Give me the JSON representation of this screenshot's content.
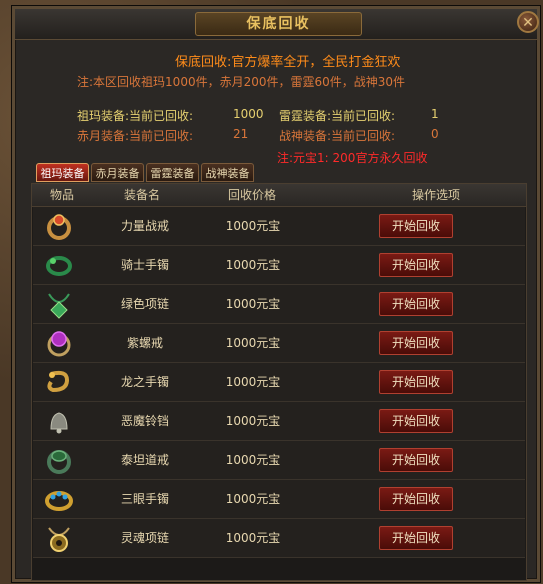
{
  "window": {
    "title": "保底回收",
    "close_symbol": "✕"
  },
  "info": {
    "headline": "保底回收:官方爆率全开，全民打金狂欢",
    "note_limit": "注:本区回收祖玛1000件，赤月200件，雷霆60件，战神30件",
    "stats": [
      {
        "label": "祖玛装备:当前已回收:",
        "value": "1000"
      },
      {
        "label": "雷霆装备:当前已回收:",
        "value": "1"
      },
      {
        "label": "赤月装备:当前已回收:",
        "value": "21"
      },
      {
        "label": "战神装备:当前已回收:",
        "value": "0"
      }
    ],
    "note_rate": "注:元宝1: 200官方永久回收"
  },
  "tabs": [
    "祖玛装备",
    "赤月装备",
    "雷霆装备",
    "战神装备"
  ],
  "table": {
    "headers": [
      "物品",
      "装备名",
      "回收价格",
      "操作选项"
    ],
    "rows": [
      {
        "name": "力量战戒",
        "price": "1000元宝",
        "button": "开始回收",
        "icon": "ring-icon"
      },
      {
        "name": "骑士手镯",
        "price": "1000元宝",
        "button": "开始回收",
        "icon": "bracelet-icon"
      },
      {
        "name": "绿色项链",
        "price": "1000元宝",
        "button": "开始回收",
        "icon": "necklace-icon"
      },
      {
        "name": "紫螺戒",
        "price": "1000元宝",
        "button": "开始回收",
        "icon": "ring-icon"
      },
      {
        "name": "龙之手镯",
        "price": "1000元宝",
        "button": "开始回收",
        "icon": "bracelet-icon"
      },
      {
        "name": "恶魔铃铛",
        "price": "1000元宝",
        "button": "开始回收",
        "icon": "bell-icon"
      },
      {
        "name": "泰坦道戒",
        "price": "1000元宝",
        "button": "开始回收",
        "icon": "ring-icon"
      },
      {
        "name": "三眼手镯",
        "price": "1000元宝",
        "button": "开始回收",
        "icon": "bracelet-icon"
      },
      {
        "name": "灵魂项链",
        "price": "1000元宝",
        "button": "开始回收",
        "icon": "necklace-icon"
      }
    ]
  }
}
